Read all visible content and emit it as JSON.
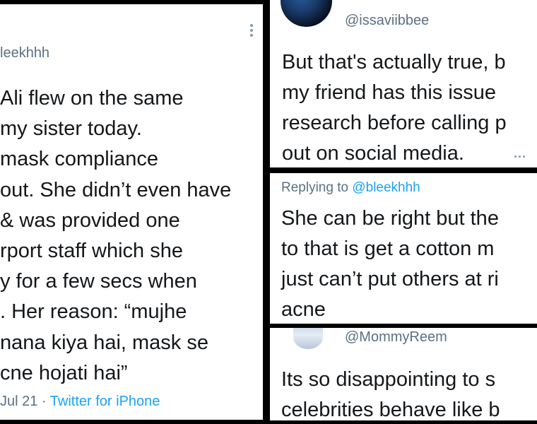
{
  "left_tweet": {
    "handle": "leekhhh",
    "lines": [
      "Ali flew on the same",
      "my sister today.",
      "mask compliance",
      "out. She didn’t even have",
      "& was provided one",
      "rport staff which she",
      "y for a few secs when",
      ". Her reason: “mujhe",
      "nana kiya hai, mask se",
      "cne hojati hai”"
    ],
    "date": "Jul 21",
    "separator": " · ",
    "source": "Twitter for iPhone"
  },
  "reply_top": {
    "handle": "@issaviibbee",
    "lines": [
      "But that's actually true, b",
      "my friend has this issue",
      "research before calling p",
      "out on social media."
    ]
  },
  "reply_middle": {
    "replying_prefix": "Replying to ",
    "replying_handle": "@bleekhhh",
    "lines": [
      "She can be right but the",
      "to that is get a cotton m",
      "just can’t put others at ri",
      "acne"
    ]
  },
  "reply_bottom": {
    "handle": "@MommyReem",
    "lines": [
      "Its so disappointing to s",
      "celebrities behave like b"
    ]
  },
  "colors": {
    "text": "#14171a",
    "secondary": "#5b7083",
    "link": "#1da1f2",
    "separator": "#000000"
  }
}
